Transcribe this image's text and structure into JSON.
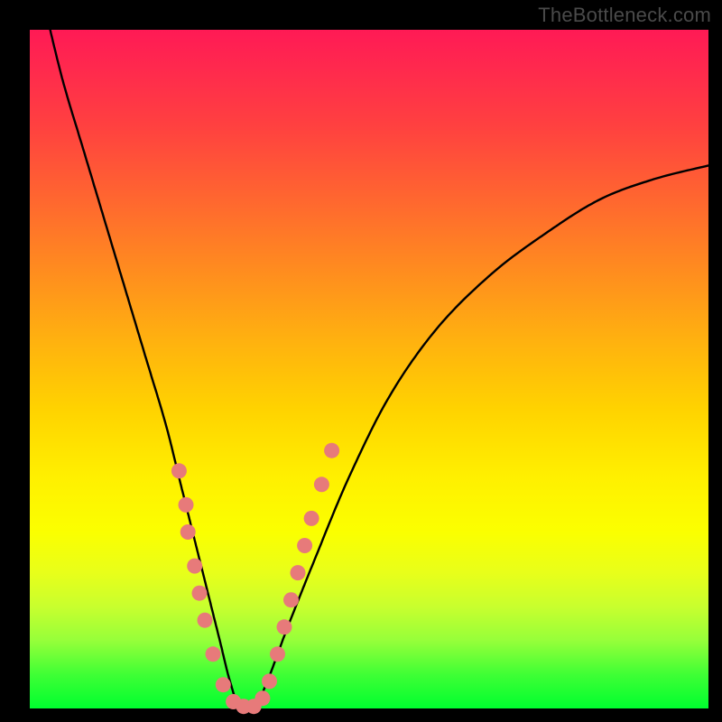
{
  "watermark": {
    "text": "TheBottleneck.com"
  },
  "chart_data": {
    "type": "line",
    "title": "",
    "xlabel": "",
    "ylabel": "",
    "xlim": [
      0,
      100
    ],
    "ylim": [
      0,
      100
    ],
    "series": [
      {
        "name": "bottleneck-curve",
        "x": [
          3,
          5,
          8,
          11,
          14,
          17,
          20,
          22,
          24,
          26,
          28,
          29.5,
          31,
          33,
          35,
          38,
          42,
          47,
          53,
          60,
          68,
          76,
          84,
          92,
          100
        ],
        "y": [
          100,
          92,
          82,
          72,
          62,
          52,
          42,
          34,
          26,
          18,
          10,
          4,
          0,
          0,
          4,
          12,
          22,
          34,
          46,
          56,
          64,
          70,
          75,
          78,
          80
        ]
      }
    ],
    "markers": {
      "name": "highlight-dots",
      "color": "#e77a7a",
      "points": [
        {
          "x": 22.0,
          "y": 35
        },
        {
          "x": 23.0,
          "y": 30
        },
        {
          "x": 23.3,
          "y": 26
        },
        {
          "x": 24.3,
          "y": 21
        },
        {
          "x": 25.0,
          "y": 17
        },
        {
          "x": 25.8,
          "y": 13
        },
        {
          "x": 27.0,
          "y": 8
        },
        {
          "x": 28.5,
          "y": 3.5
        },
        {
          "x": 30.0,
          "y": 1.0
        },
        {
          "x": 31.5,
          "y": 0.3
        },
        {
          "x": 33.0,
          "y": 0.3
        },
        {
          "x": 34.3,
          "y": 1.5
        },
        {
          "x": 35.3,
          "y": 4.0
        },
        {
          "x": 36.5,
          "y": 8.0
        },
        {
          "x": 37.5,
          "y": 12.0
        },
        {
          "x": 38.5,
          "y": 16.0
        },
        {
          "x": 39.5,
          "y": 20.0
        },
        {
          "x": 40.5,
          "y": 24.0
        },
        {
          "x": 41.5,
          "y": 28.0
        },
        {
          "x": 43.0,
          "y": 33.0
        },
        {
          "x": 44.5,
          "y": 38.0
        }
      ]
    },
    "gradient_colormap": "red-yellow-green (vertical, red=high, green=low)"
  }
}
